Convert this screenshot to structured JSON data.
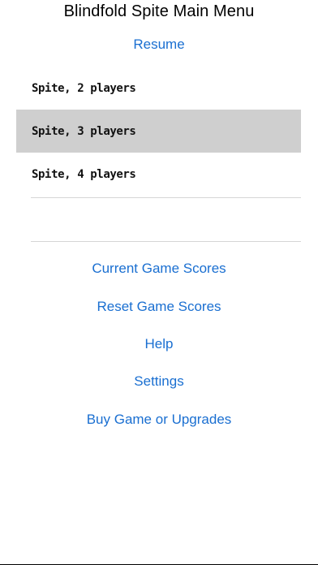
{
  "header": {
    "title": "Blindfold Spite Main Menu"
  },
  "resume_label": "Resume",
  "games": [
    {
      "label": "Spite, 2 players",
      "selected": false
    },
    {
      "label": "Spite, 3 players",
      "selected": true
    },
    {
      "label": "Spite, 4 players",
      "selected": false
    }
  ],
  "menu": {
    "current_scores": "Current Game Scores",
    "reset_scores": "Reset Game Scores",
    "help": "Help",
    "settings": "Settings",
    "buy": "Buy Game or Upgrades"
  },
  "colors": {
    "link": "#1a6fd1",
    "selected_row": "#cfcfcf",
    "divider": "#d6d6d6"
  }
}
